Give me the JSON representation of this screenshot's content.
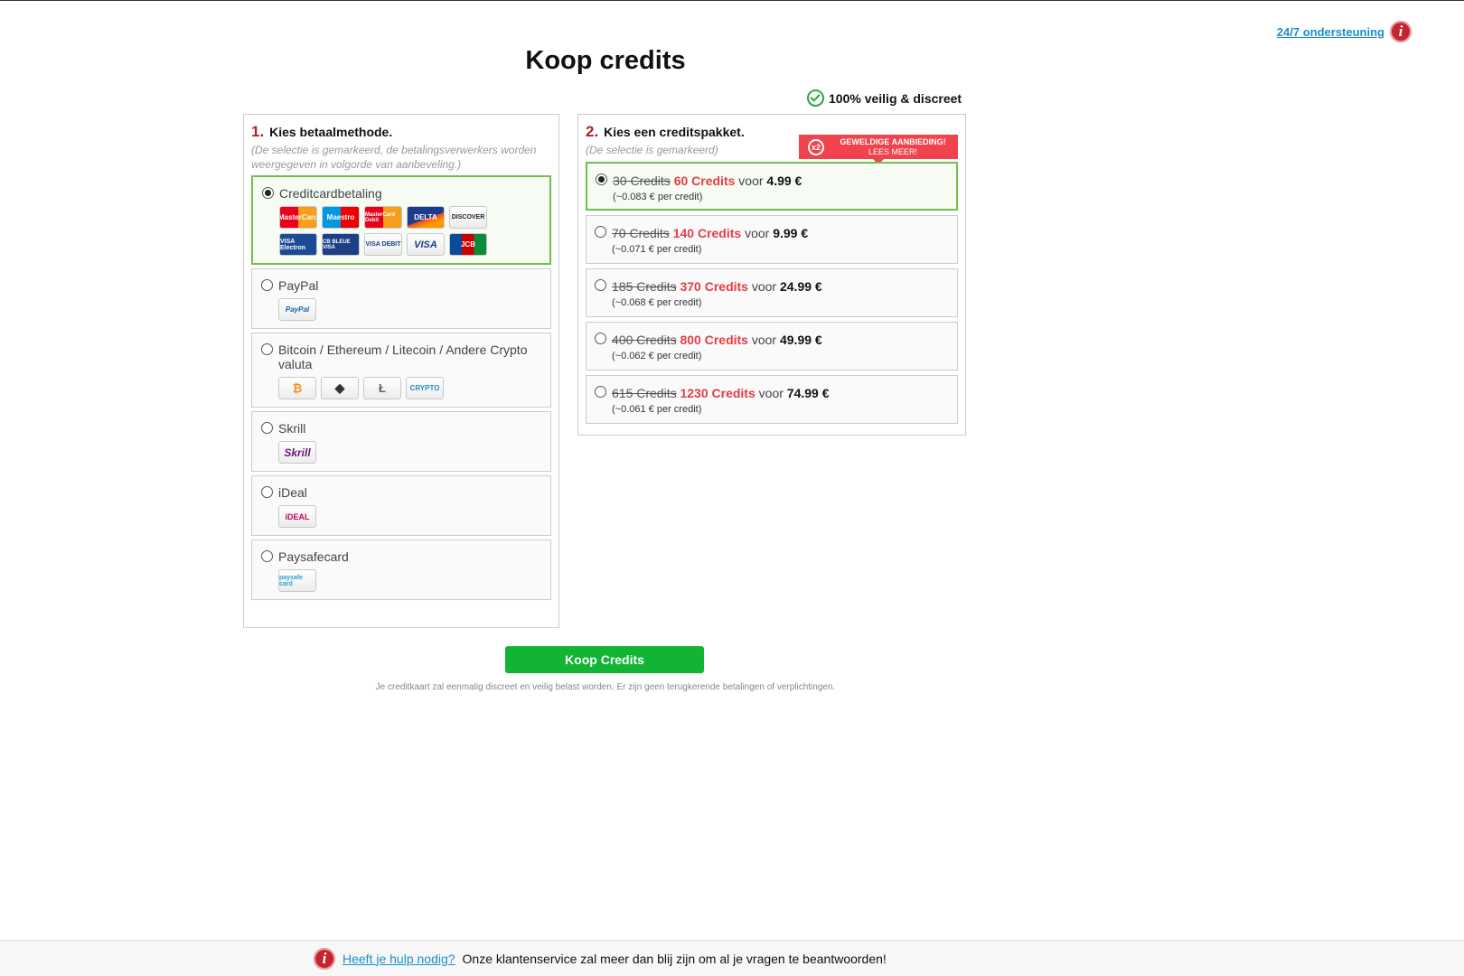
{
  "support": {
    "label": "24/7 ondersteuning"
  },
  "title": "Koop credits",
  "secure_label": "100% veilig & discreet",
  "payment": {
    "step_num": "1.",
    "step_title": "Kies betaalmethode.",
    "hint": "(De selectie is gemarkeerd, de betalingsverwerkers worden weergegeven in volgorde van aanbeveling.)",
    "methods": [
      {
        "label": "Creditcardbetaling",
        "selected": true,
        "logos": [
          "MasterCard",
          "Maestro",
          "MasterCard Debit",
          "DELTA",
          "DISCOVER",
          "VISA Electron",
          "CB BLEUE VISA",
          "VISA DEBIT",
          "VISA",
          "JCB"
        ]
      },
      {
        "label": "PayPal",
        "selected": false,
        "logos": [
          "PayPal"
        ]
      },
      {
        "label": "Bitcoin / Ethereum / Litecoin / Andere Crypto valuta",
        "selected": false,
        "logos": [
          "₿",
          "◆",
          "Ł",
          "CRYPTO"
        ]
      },
      {
        "label": "Skrill",
        "selected": false,
        "logos": [
          "Skrill"
        ]
      },
      {
        "label": "iDeal",
        "selected": false,
        "logos": [
          "iDEAL"
        ]
      },
      {
        "label": "Paysafecard",
        "selected": false,
        "logos": [
          "paysafe card"
        ]
      }
    ]
  },
  "packages": {
    "step_num": "2.",
    "step_title": "Kies een creditspakket.",
    "hint": "(De selectie is gemarkeerd)",
    "promo": {
      "badge": "x2",
      "line1": "GEWELDIGE AANBIEDING!",
      "line2": "LEES MEER!"
    },
    "items": [
      {
        "old": "30 Credits",
        "new": "60 Credits",
        "voor": "voor",
        "price": "4.99 €",
        "per": "(~0.083 € per credit)",
        "selected": true
      },
      {
        "old": "70 Credits",
        "new": "140 Credits",
        "voor": "voor",
        "price": "9.99 €",
        "per": "(~0.071 € per credit)",
        "selected": false
      },
      {
        "old": "185 Credits",
        "new": "370 Credits",
        "voor": "voor",
        "price": "24.99 €",
        "per": "(~0.068 € per credit)",
        "selected": false
      },
      {
        "old": "400 Credits",
        "new": "800 Credits",
        "voor": "voor",
        "price": "49.99 €",
        "per": "(~0.062 € per credit)",
        "selected": false
      },
      {
        "old": "615 Credits",
        "new": "1230 Credits",
        "voor": "voor",
        "price": "74.99 €",
        "per": "(~0.061 € per credit)",
        "selected": false
      }
    ]
  },
  "buy_button": "Koop Credits",
  "note": "Je creditkaart zal eenmalig discreet en veilig belast worden. Er zijn geen terugkerende betalingen of verplichtingen.",
  "footer": {
    "link": "Heeft je hulp nodig?",
    "text": "Onze klantenservice zal meer dan blij zijn om al je vragen te beantwoorden!"
  },
  "colors": {
    "accent_red": "#b0212b",
    "buy_green": "#12b434",
    "selected_border": "#6fbf4c",
    "link_blue": "#1a8fc9"
  }
}
